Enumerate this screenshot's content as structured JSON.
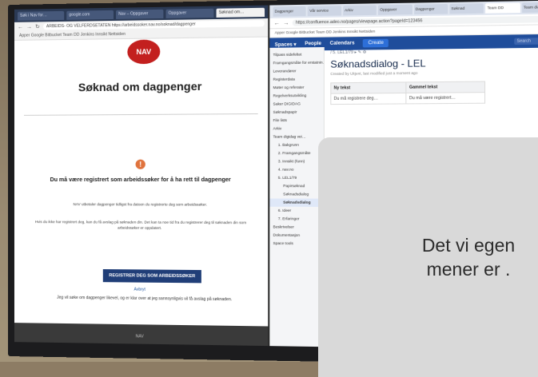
{
  "left_browser": {
    "tabs": [
      "Søk i Nav for…",
      "google.com",
      "Nav – Oppgaver",
      "Oppgaver",
      "Søknad om…"
    ],
    "url": "ARBEIDS- OG VELFERDSETATEN  https://arbeidssoker.nav.no/soknad/dagpenger",
    "bookmarks": "Apper   Google   Bitbucket   Team DD   Jenkins   Innsikt   Nettsiden",
    "logo": "NAV",
    "title": "Søknad om dagpenger",
    "warning_symbol": "!",
    "heading": "Du må være registrert som arbeidssøker for å ha rett til dagpenger",
    "para1": "NAV utbetaler dagpenger tidligst fra datoen du registrerte deg som arbeidssøker.",
    "para2": "Hvis du ikke har registrert deg, kan du få avslag på søknaden din. Det kan ta noe tid fra du registrerer deg til søknaden din som arbeidssøker er oppdatert.",
    "button": "REGISTRER DEG SOM ARBEIDSSØKER",
    "cancel": "Avbryt",
    "note": "Jeg vil søke om dagpenger likevel, og er klar over at jeg sannsynligvis vil få avslag på søknaden.",
    "footer": "NAV"
  },
  "right_browser": {
    "tabs": [
      "Dagpenger",
      "Vår service",
      "Arkiv",
      "Oppgaver",
      "Dagpenger",
      "Søknad",
      "Team DD",
      "Team dialog"
    ],
    "url": "https://confluence.adeo.no/pages/viewpage.action?pageId=123456",
    "bookmarks": "Apper   Google   Bitbucket   Team DD   Jenkins   Innsikt   Nettsiden",
    "topnav": {
      "spaces": "Spaces ▾",
      "people": "People",
      "calendars": "Calendars",
      "create": "Create",
      "search": "Search"
    },
    "sidebar": [
      {
        "label": "Tilpass sidefeltet",
        "level": 0
      },
      {
        "label": "Framgangsmåte for erstatnin…",
        "level": 0
      },
      {
        "label": "Leverandører",
        "level": 0
      },
      {
        "label": "Registerdata",
        "level": 0
      },
      {
        "label": "Møter og referater",
        "level": 0
      },
      {
        "label": "Regelverksutvikling",
        "level": 0
      },
      {
        "label": "Saker DIGIDAG",
        "level": 0
      },
      {
        "label": "Søknadspapir",
        "level": 0
      },
      {
        "label": "File lists",
        "level": 0
      },
      {
        "label": "Arkiv",
        "level": 0
      },
      {
        "label": "Team digidag vei…",
        "level": 0
      },
      {
        "label": "1. Bakgrunn",
        "level": 1
      },
      {
        "label": "2. Framgangsmåte",
        "level": 1
      },
      {
        "label": "3. Innsikt (funn)",
        "level": 1
      },
      {
        "label": "4. nav.no",
        "level": 1
      },
      {
        "label": "5. LEL1/79",
        "level": 1
      },
      {
        "label": "Papirsøknad",
        "level": 2
      },
      {
        "label": "Søknadsdialog",
        "level": 2
      },
      {
        "label": "Søknadsdialog",
        "level": 2
      },
      {
        "label": "6. Ideer",
        "level": 1
      },
      {
        "label": "7. Erfaringer",
        "level": 1
      },
      {
        "label": "Beskrivelser",
        "level": 0
      },
      {
        "label": "Dokumentasjon",
        "level": 0
      },
      {
        "label": "Space tools",
        "level": 0
      }
    ],
    "breadcrumb": "/ 5. LEL1/79  ▸  ✎  ⚙",
    "page_title": "Søknadsdialog - LEL",
    "page_meta": "Created by Ukjent, last modified just a moment ago",
    "table_headers": [
      "Ny tekst",
      "Gammel tekst"
    ],
    "table_rows": [
      [
        "Du må registrere deg…",
        "Du må være registrert…"
      ]
    ]
  },
  "overlay": {
    "line1": "Det vi egen",
    "line2": "mener er ."
  }
}
